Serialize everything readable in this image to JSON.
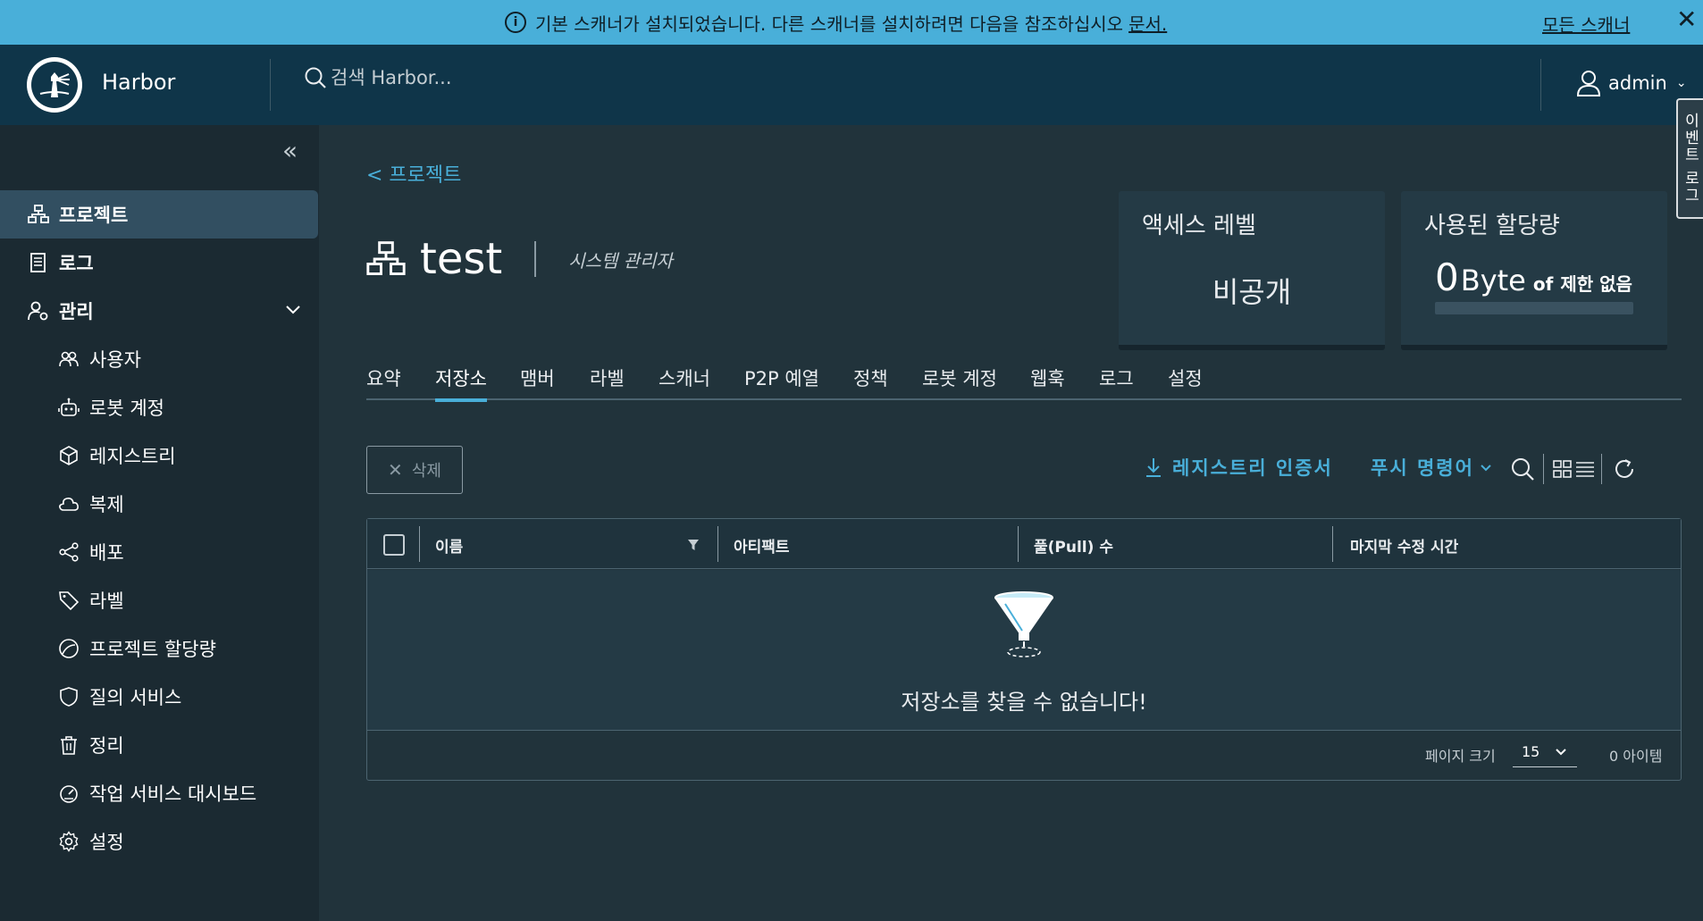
{
  "banner": {
    "message": "기본 스캐너가 설치되었습니다. 다른 스캐너를 설치하려면 다음을 참조하십시오",
    "link": "문서.",
    "all_scanners": "모든 스캐너",
    "close": "✕"
  },
  "header": {
    "app_name": "Harbor",
    "search_placeholder": "검색 Harbor...",
    "user": "admin"
  },
  "side_tab": "이벤트 로그",
  "sidebar": {
    "items": [
      {
        "label": "프로젝트"
      },
      {
        "label": "로그"
      },
      {
        "label": "관리"
      },
      {
        "label": "사용자"
      },
      {
        "label": "로봇 계정"
      },
      {
        "label": "레지스트리"
      },
      {
        "label": "복제"
      },
      {
        "label": "배포"
      },
      {
        "label": "라벨"
      },
      {
        "label": "프로젝트 할당량"
      },
      {
        "label": "질의 서비스"
      },
      {
        "label": "정리"
      },
      {
        "label": "작업 서비스 대시보드"
      },
      {
        "label": "설정"
      }
    ]
  },
  "main": {
    "breadcrumb": "< 프로젝트",
    "project_name": "test",
    "role": "시스템 관리자",
    "access_card": {
      "title": "액세스 레벨",
      "value": "비공개"
    },
    "quota_card": {
      "title": "사용된 할당량",
      "num": "0",
      "unit": "Byte",
      "of": "of",
      "limit": "제한 없음",
      "usage_fraction": 0
    },
    "tabs": [
      "요약",
      "저장소",
      "맴버",
      "라벨",
      "스캐너",
      "P2P 예열",
      "정책",
      "로봇 계정",
      "웹훅",
      "로그",
      "설정"
    ],
    "active_tab": "저장소",
    "delete_button": "삭제",
    "registry_cert": "레지스트리 인증서",
    "push_command": "푸시 명령어",
    "table": {
      "columns": [
        "이름",
        "아티팩트",
        "풀(Pull) 수",
        "마지막 수정 시간"
      ],
      "empty_message": "저장소를 찾을 수 없습니다!"
    },
    "pagination": {
      "page_size_label": "페이지 크기",
      "page_size": "15",
      "count": "0 아이템"
    }
  },
  "colors": {
    "accent": "#49afd9",
    "header_bg": "#0f3549",
    "sidebar_bg": "#1b2a32",
    "main_bg": "#21333b"
  }
}
